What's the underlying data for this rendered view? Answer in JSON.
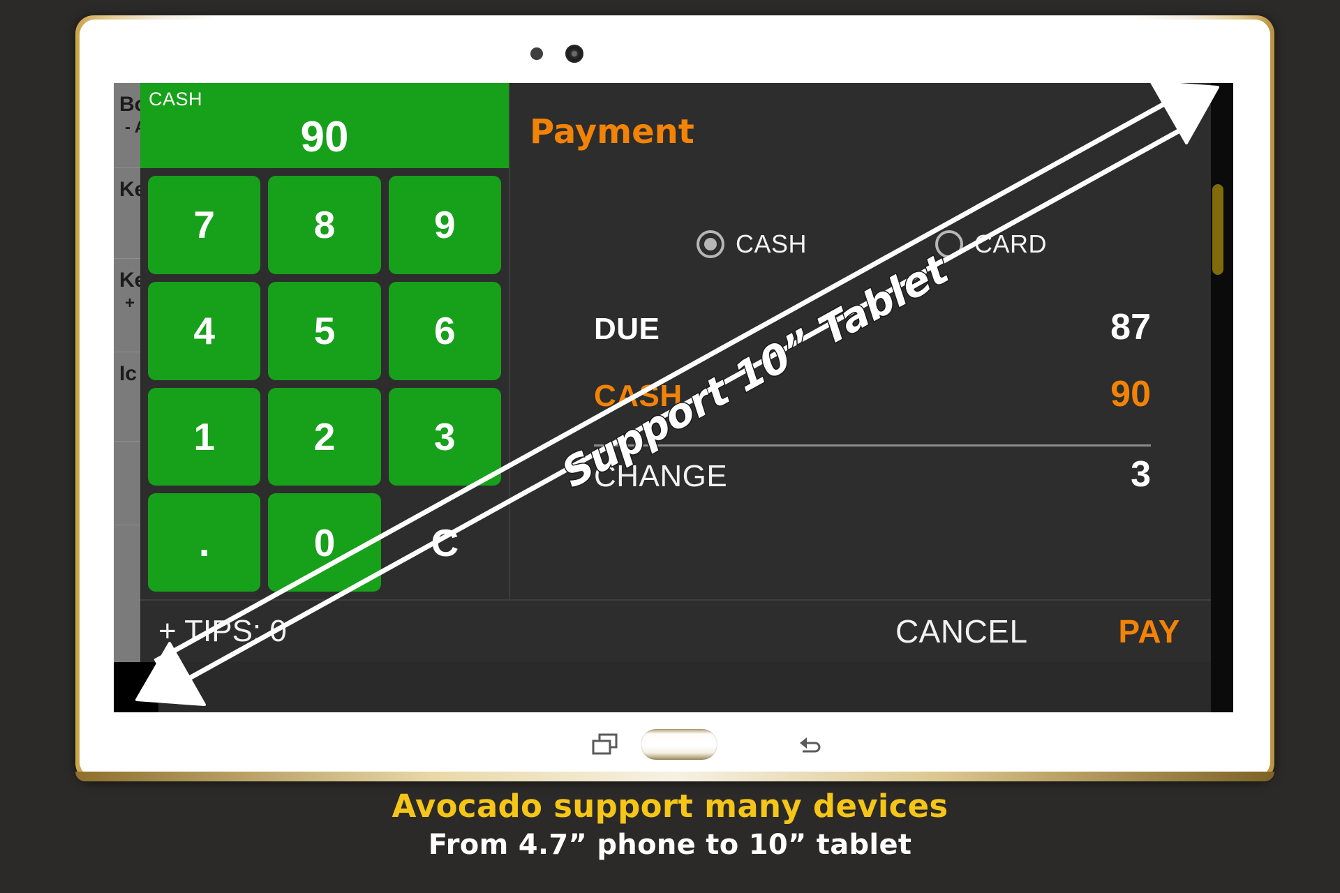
{
  "app": {
    "background_list": [
      {
        "main": "Bo",
        "sub": "- A"
      },
      {
        "main": "Ke",
        "sub": ""
      },
      {
        "main": "Ke",
        "sub": "+"
      },
      {
        "main": "Ic",
        "sub": ""
      }
    ]
  },
  "keypad": {
    "display_label": "CASH",
    "display_value": "90",
    "keys": [
      "7",
      "8",
      "9",
      "4",
      "5",
      "6",
      "1",
      "2",
      "3",
      ".",
      "0",
      "C"
    ]
  },
  "payment": {
    "title": "Payment",
    "methods": [
      {
        "label": "CASH",
        "selected": true
      },
      {
        "label": "CARD",
        "selected": false
      }
    ],
    "rows": [
      {
        "label": "DUE",
        "value": "87"
      },
      {
        "label": "CASH",
        "value": "90"
      },
      {
        "label": "CHANGE",
        "value": "3"
      }
    ]
  },
  "actionbar": {
    "tips": "+ TIPS: 0",
    "cancel": "CANCEL",
    "pay": "PAY"
  },
  "annotation": {
    "arrow_label": "Support 10” Tablet"
  },
  "caption": {
    "line1": "Avocado support many devices",
    "line2": "From 4.7” phone to 10” tablet"
  },
  "colors": {
    "accent_orange": "#f28307",
    "key_green": "#17a01a",
    "caption_yellow": "#f5c518",
    "panel_dark": "#2d2d2d"
  }
}
